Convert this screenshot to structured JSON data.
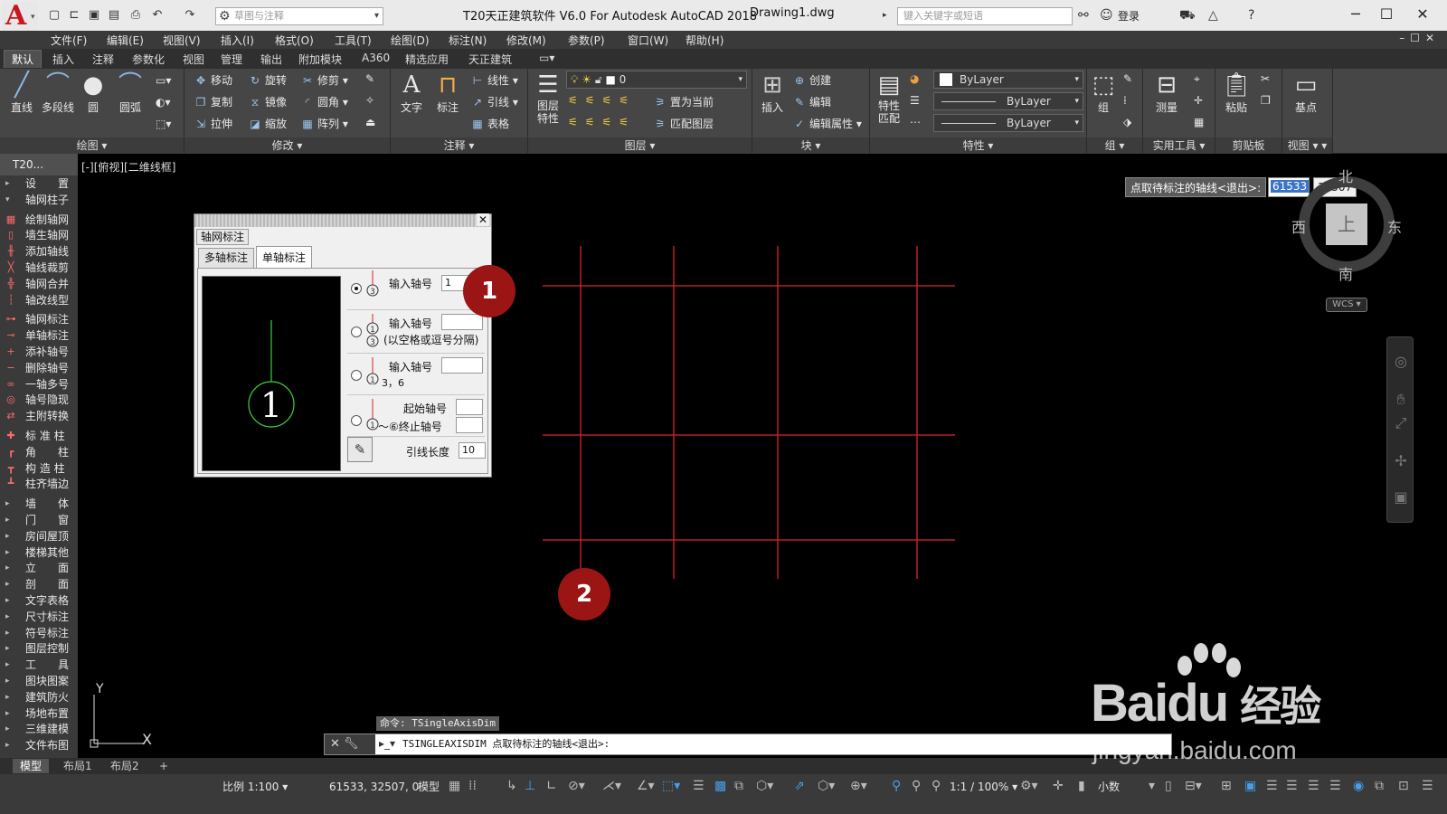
{
  "titlebar": {
    "app_title": "T20天正建筑软件 V6.0 For Autodesk AutoCAD 2018",
    "doc_name": "Drawing1.dwg",
    "workspace_placeholder": "草图与注释",
    "search_placeholder": "键入关键字或短语",
    "login": "登录"
  },
  "menu": [
    "文件(F)",
    "编辑(E)",
    "视图(V)",
    "插入(I)",
    "格式(O)",
    "工具(T)",
    "绘图(D)",
    "标注(N)",
    "修改(M)",
    "参数(P)",
    "窗口(W)",
    "帮助(H)"
  ],
  "ribbon_tabs": [
    "默认",
    "插入",
    "注释",
    "参数化",
    "视图",
    "管理",
    "输出",
    "附加模块",
    "A360",
    "精选应用",
    "天正建筑"
  ],
  "ribbon": {
    "draw": {
      "title": "绘图",
      "line": "直线",
      "polyline": "多段线",
      "circle": "圆",
      "arc": "圆弧"
    },
    "modify": {
      "title": "修改",
      "move": "移动",
      "rotate": "旋转",
      "trim": "修剪",
      "copy": "复制",
      "mirror": "镜像",
      "fillet": "圆角",
      "stretch": "拉伸",
      "scale": "缩放",
      "array": "阵列"
    },
    "annotate": {
      "title": "注释",
      "text": "文字",
      "dim": "标注",
      "linear": "线性",
      "leader": "引线",
      "table": "表格"
    },
    "layers": {
      "title": "图层",
      "props": "图层特性",
      "layer_value": "0",
      "set_current": "置为当前",
      "match_layer": "匹配图层"
    },
    "block": {
      "title": "块",
      "insert": "插入",
      "create": "创建",
      "edit": "编辑",
      "edit_attr": "编辑属性"
    },
    "properties": {
      "title": "特性",
      "match": "特性匹配",
      "color": "ByLayer",
      "linetype": "ByLayer",
      "lineweight": "ByLayer"
    },
    "group": {
      "title": "组",
      "group": "组"
    },
    "utilities": {
      "title": "实用工具",
      "measure": "测量"
    },
    "clipboard": {
      "title": "剪贴板",
      "paste": "粘贴"
    },
    "view": {
      "title": "视图",
      "base": "基点"
    }
  },
  "palette": {
    "header": "T20...",
    "items": [
      {
        "label": "设　　置",
        "arrow": "▸"
      },
      {
        "label": "轴网柱子",
        "arrow": "▾"
      },
      {
        "label": "绘制轴网",
        "icon": "▦"
      },
      {
        "label": "墙生轴网",
        "icon": "▯"
      },
      {
        "label": "添加轴线",
        "icon": "╫"
      },
      {
        "label": "轴线裁剪",
        "icon": "╳"
      },
      {
        "label": "轴网合并",
        "icon": "╬"
      },
      {
        "label": "轴改线型",
        "icon": "┆"
      },
      {
        "label": "轴网标注",
        "icon": "⊶"
      },
      {
        "label": "单轴标注",
        "icon": "⊸"
      },
      {
        "label": "添补轴号",
        "icon": "+"
      },
      {
        "label": "删除轴号",
        "icon": "−"
      },
      {
        "label": "一轴多号",
        "icon": "∞"
      },
      {
        "label": "轴号隐现",
        "icon": "◎"
      },
      {
        "label": "主附转换",
        "icon": "⇄"
      },
      {
        "label": "标 准 柱",
        "icon": "✚"
      },
      {
        "label": "角　　柱",
        "icon": "┏"
      },
      {
        "label": "构 造 柱",
        "icon": "┳"
      },
      {
        "label": "柱齐墙边",
        "icon": "┻"
      },
      {
        "label": "墙　　体",
        "arrow": "▸"
      },
      {
        "label": "门　　窗",
        "arrow": "▸"
      },
      {
        "label": "房间屋顶",
        "arrow": "▸"
      },
      {
        "label": "楼梯其他",
        "arrow": "▸"
      },
      {
        "label": "立　　面",
        "arrow": "▸"
      },
      {
        "label": "剖　　面",
        "arrow": "▸"
      },
      {
        "label": "文字表格",
        "arrow": "▸"
      },
      {
        "label": "尺寸标注",
        "arrow": "▸"
      },
      {
        "label": "符号标注",
        "arrow": "▸"
      },
      {
        "label": "图层控制",
        "arrow": "▸"
      },
      {
        "label": "工　　具",
        "arrow": "▸"
      },
      {
        "label": "图块图案",
        "arrow": "▸"
      },
      {
        "label": "建筑防火",
        "arrow": "▸"
      },
      {
        "label": "场地布置",
        "arrow": "▸"
      },
      {
        "label": "三维建模",
        "arrow": "▸"
      },
      {
        "label": "文件布图",
        "arrow": "▸"
      }
    ]
  },
  "viewport_label": "[-][俯视][二维线框]",
  "dynamic_input": {
    "prompt": "点取待标注的轴线<退出>:",
    "x": "61533",
    "y": "32507"
  },
  "viewcube": {
    "north": "北",
    "south": "南",
    "east": "东",
    "west": "西",
    "face": "上",
    "wcs": "WCS"
  },
  "dialog": {
    "title": "轴网标注",
    "tabs": [
      "多轴标注",
      "单轴标注"
    ],
    "active_tab": 1,
    "preview_number": "1",
    "option1_label": "输入轴号",
    "option1_value": "1",
    "option1_sym": "3",
    "option2_label": "输入轴号",
    "option2_hint": "(以空格或逗号分隔)",
    "option2_sym_a": "1",
    "option2_sym_b": "3",
    "option3_label": "输入轴号",
    "option3_hint": "3，6",
    "option3_sym": "1",
    "option4_start": "起始轴号",
    "option4_end": "～⑥终止轴号",
    "option4_sym": "1",
    "leader_label": "引线长度",
    "leader_value": "10"
  },
  "markers": [
    "1",
    "2"
  ],
  "command": {
    "history": "命令: TSingleAxisDim",
    "current": "TSINGLEAXISDIM 点取待标注的轴线<退出>:"
  },
  "ucs": {
    "x": "X",
    "y": "Y"
  },
  "layout_tabs": [
    "模型",
    "布局1",
    "布局2",
    "+"
  ],
  "status": {
    "scale": "比例 1:100",
    "coords": "61533, 32507, 0",
    "mode": "模型",
    "annotation_scale": "1:1 / 100%",
    "units": "小数"
  },
  "watermark": {
    "brand": "Bai",
    "brand2": "du",
    "brand3": "经验",
    "url": "jingyan.baidu.com"
  }
}
